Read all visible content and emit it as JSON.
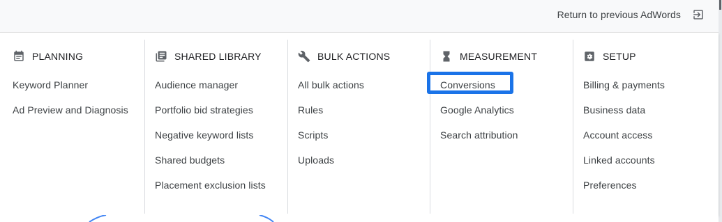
{
  "topbar": {
    "return_label": "Return to previous AdWords",
    "return_icon": "exit-to-app-icon"
  },
  "columns": [
    {
      "title": "PLANNING",
      "icon": "calendar-icon",
      "items": [
        "Keyword Planner",
        "Ad Preview and Diagnosis"
      ]
    },
    {
      "title": "SHARED LIBRARY",
      "icon": "library-icon",
      "items": [
        "Audience manager",
        "Portfolio bid strategies",
        "Negative keyword lists",
        "Shared budgets",
        "Placement exclusion lists"
      ]
    },
    {
      "title": "BULK ACTIONS",
      "icon": "wrench-icon",
      "items": [
        "All bulk actions",
        "Rules",
        "Scripts",
        "Uploads"
      ]
    },
    {
      "title": "MEASUREMENT",
      "icon": "hourglass-icon",
      "items": [
        "Conversions",
        "Google Analytics",
        "Search attribution"
      ]
    },
    {
      "title": "SETUP",
      "icon": "settings-icon",
      "items": [
        "Billing & payments",
        "Business data",
        "Account access",
        "Linked accounts",
        "Preferences"
      ]
    }
  ],
  "highlighted_item": "Conversions",
  "colors": {
    "highlight": "#1a73e8",
    "icon": "#5f6368",
    "text": "#3c4043",
    "topbar_bg": "#f8f9fa"
  }
}
